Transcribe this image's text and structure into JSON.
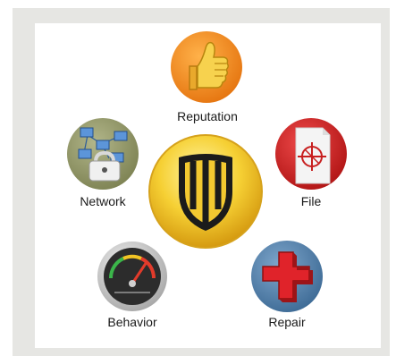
{
  "diagram": {
    "center": {
      "icon": "shield-icon"
    },
    "nodes": [
      {
        "id": "reputation",
        "label": "Reputation",
        "icon": "thumbs-up-icon",
        "color": "#f28a1c"
      },
      {
        "id": "file",
        "label": "File",
        "icon": "document-target-icon",
        "color": "#c41e1e"
      },
      {
        "id": "network",
        "label": "Network",
        "icon": "network-lock-icon",
        "color": "#8f9465"
      },
      {
        "id": "behavior",
        "label": "Behavior",
        "icon": "gauge-icon",
        "color": "#333333"
      },
      {
        "id": "repair",
        "label": "Repair",
        "icon": "red-cross-icon",
        "color": "#4f7fa8"
      }
    ]
  }
}
